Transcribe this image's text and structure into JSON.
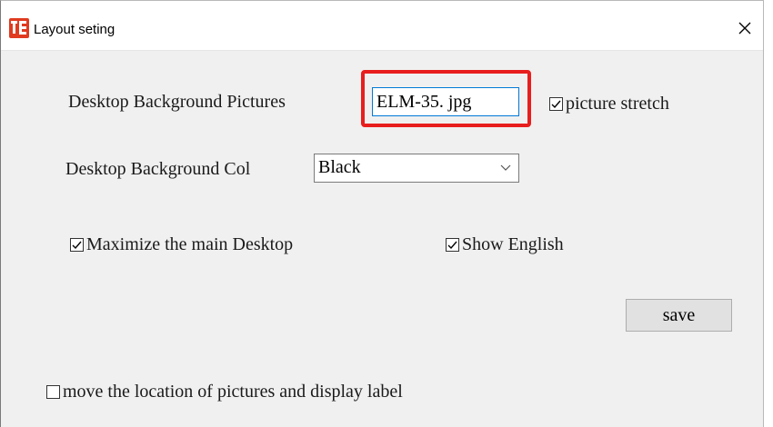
{
  "window": {
    "title": "Layout seting",
    "icon": "app-logo-icon",
    "close_icon": "close-icon"
  },
  "form": {
    "bg_picture_label": "Desktop Background Pictures",
    "bg_picture_value": "ELM-35. jpg",
    "picture_stretch_label": "picture stretch",
    "picture_stretch_checked": true,
    "bg_color_label": "Desktop Background Col",
    "bg_color_value": "Black",
    "maximize_label": "Maximize the main Desktop",
    "maximize_checked": true,
    "show_english_label": "Show English",
    "show_english_checked": true,
    "save_label": "save",
    "move_location_label": "move the location of pictures and display label",
    "move_location_checked": false
  },
  "colors": {
    "highlight": "#e81e1e",
    "input_focus_border": "#0078d7",
    "window_bg": "#f0f0f0"
  }
}
